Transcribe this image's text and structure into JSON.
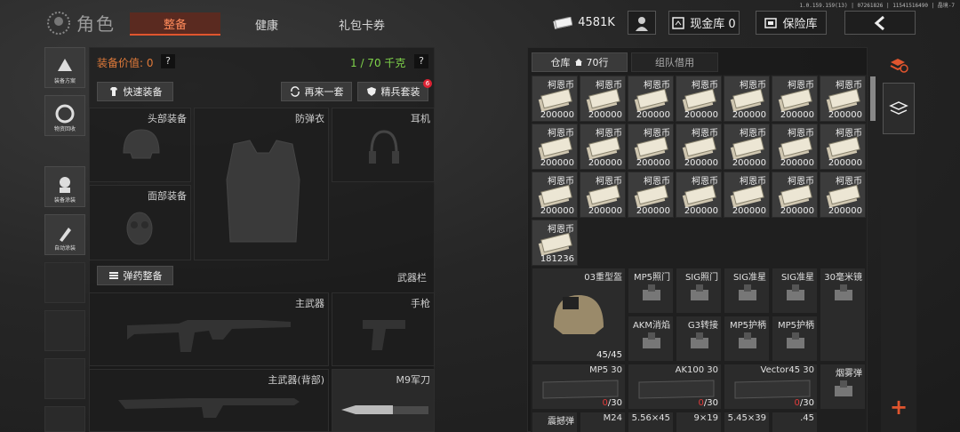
{
  "version": "1.0.159.159(13) | 07261826 | 11541516490 | 晶境-7",
  "title": "角色",
  "tabs": [
    "整备",
    "健康",
    "礼包卡券"
  ],
  "currency": {
    "value": "4581K"
  },
  "cash_vault": "现金库 0",
  "insurance": "保险库",
  "side_items": [
    "装备方案",
    "物资回收",
    "装备涂装",
    "自动涂装"
  ],
  "loadout": {
    "value_label": "装备价值: 0",
    "help": "?",
    "weight": "1 / 70 千克",
    "quick_btn": "快速装备",
    "again_btn": "再来一套",
    "elite_btn": "精兵套装",
    "elite_badge": "6"
  },
  "slots": {
    "head": "头部装备",
    "armor": "防弹衣",
    "ear": "耳机",
    "face": "面部装备",
    "ammo_btn": "弹药整备",
    "weapon_bar": "武器栏",
    "primary": "主武器",
    "pistol": "手枪",
    "primary_back": "主武器(背部)",
    "knife": "M9军刀"
  },
  "warehouse": {
    "tab1": "仓库",
    "tab1_count": "70行",
    "tab2": "组队借用"
  },
  "money_name": "柯恩币",
  "money_counts": [
    "200000",
    "200000",
    "200000",
    "200000",
    "200000",
    "200000",
    "200000",
    "200000",
    "200000",
    "200000",
    "200000",
    "200000",
    "200000",
    "200000",
    "200000",
    "200000",
    "200000",
    "200000",
    "200000",
    "200000",
    "200000",
    "181236"
  ],
  "items": [
    {
      "n": "03重型盔",
      "c": "45/45"
    },
    {
      "n": "MP5照门"
    },
    {
      "n": "SIG照门"
    },
    {
      "n": "SIG准星"
    },
    {
      "n": "SIG准星"
    },
    {
      "n": "30毫米镜"
    },
    {
      "n": "AKM消焰"
    },
    {
      "n": "G3转接"
    },
    {
      "n": "MP5护柄"
    },
    {
      "n": "MP5护柄"
    },
    {
      "n": "MP5 30",
      "c0": "0",
      "c1": "/30"
    },
    {
      "n": "AK100 30",
      "c0": "0",
      "c1": "/30"
    },
    {
      "n": "Vector45 30",
      "c0": "0",
      "c1": "/30"
    },
    {
      "n": "烟雾弹"
    },
    {
      "n": "震撼弹"
    },
    {
      "n": "M24"
    },
    {
      "n": "5.56×45"
    },
    {
      "n": "9×19"
    },
    {
      "n": "5.45×39"
    },
    {
      "n": ".45"
    }
  ],
  "add": "+",
  "colors": {
    "accent": "#e0552e",
    "green": "#7fd34a",
    "orange": "#e07a3a"
  }
}
